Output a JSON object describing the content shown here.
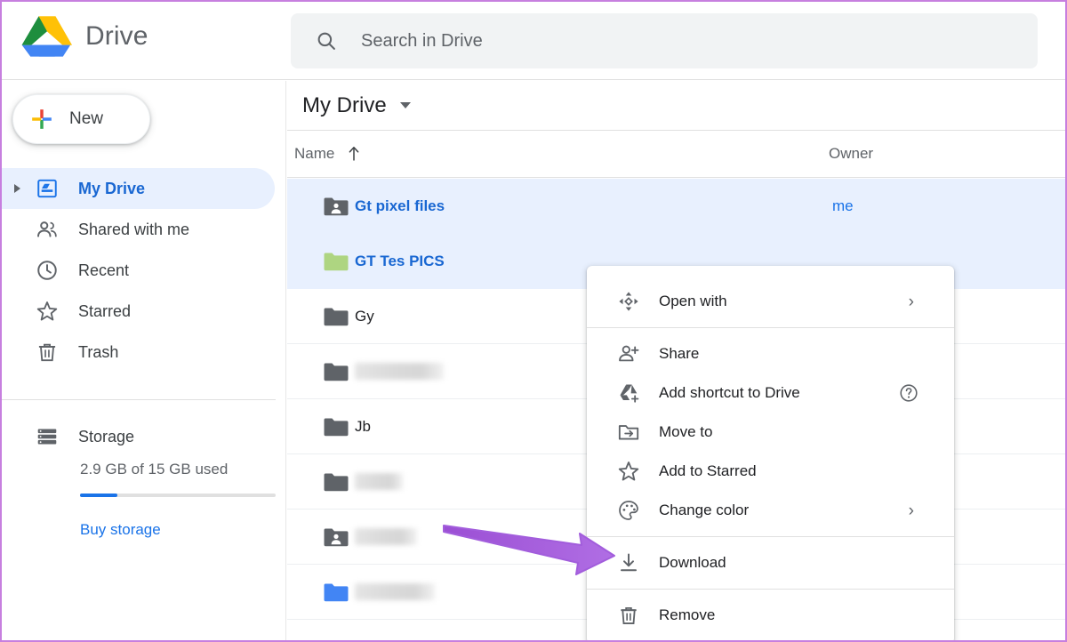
{
  "window": {
    "border_color": "#c77fdf"
  },
  "header": {
    "app_title": "Drive",
    "logo_icon": "google-drive-logo",
    "search": {
      "icon": "search-icon",
      "placeholder": "Search in Drive",
      "value": ""
    }
  },
  "sidebar": {
    "new_button": {
      "label": "New",
      "icon": "plus-icon"
    },
    "items": [
      {
        "label": "My Drive",
        "icon": "my-drive-icon",
        "selected": true,
        "expandable": true
      },
      {
        "label": "Shared with me",
        "icon": "people-icon",
        "selected": false,
        "expandable": false
      },
      {
        "label": "Recent",
        "icon": "clock-icon",
        "selected": false,
        "expandable": false
      },
      {
        "label": "Starred",
        "icon": "star-icon",
        "selected": false,
        "expandable": false
      },
      {
        "label": "Trash",
        "icon": "trash-icon",
        "selected": false,
        "expandable": false
      }
    ],
    "storage": {
      "icon": "storage-icon",
      "label": "Storage",
      "used_text": "2.9 GB of 15 GB used",
      "used_percent": 19,
      "bar_color": "#1a73e8",
      "buy_link": "Buy storage"
    }
  },
  "main": {
    "breadcrumb": {
      "title": "My Drive",
      "caret_icon": "chevron-down-icon"
    },
    "columns": {
      "name": "Name",
      "name_sort_icon": "arrow-up-icon",
      "owner": "Owner"
    },
    "rows": [
      {
        "name": "Gt pixel files",
        "icon": "shared-folder-icon",
        "icon_color": "#5f6368",
        "owner": "me",
        "selected": true,
        "redacted": false
      },
      {
        "name": "GT Tes PICS",
        "icon": "folder-icon",
        "icon_color": "#aed581",
        "owner": "",
        "selected": true,
        "redacted": false
      },
      {
        "name": "Gy",
        "icon": "folder-icon",
        "icon_color": "#5f6368",
        "owner": "",
        "selected": false,
        "redacted": false
      },
      {
        "name": "",
        "icon": "folder-icon",
        "icon_color": "#5f6368",
        "owner": "",
        "selected": false,
        "redacted": true,
        "redact_width": 100
      },
      {
        "name": "Jb",
        "icon": "folder-icon",
        "icon_color": "#5f6368",
        "owner": "",
        "selected": false,
        "redacted": false
      },
      {
        "name": "",
        "icon": "folder-icon",
        "icon_color": "#5f6368",
        "owner": "",
        "selected": false,
        "redacted": true,
        "redact_width": 54
      },
      {
        "name": "",
        "icon": "shared-folder-icon",
        "icon_color": "#5f6368",
        "owner": "",
        "selected": false,
        "redacted": true,
        "redact_width": 70
      },
      {
        "name": "",
        "icon": "folder-icon",
        "icon_color": "#4285f4",
        "owner": "",
        "selected": false,
        "redacted": true,
        "redact_width": 90
      }
    ]
  },
  "context_menu": {
    "groups": [
      {
        "items": [
          {
            "label": "Open with",
            "icon": "open-with-icon",
            "submenu": true,
            "help": false
          }
        ]
      },
      {
        "items": [
          {
            "label": "Share",
            "icon": "person-add-icon",
            "submenu": false,
            "help": false
          },
          {
            "label": "Add shortcut to Drive",
            "icon": "add-shortcut-icon",
            "submenu": false,
            "help": true
          },
          {
            "label": "Move to",
            "icon": "move-to-folder-icon",
            "submenu": false,
            "help": false
          },
          {
            "label": "Add to Starred",
            "icon": "star-icon",
            "submenu": false,
            "help": false
          },
          {
            "label": "Change color",
            "icon": "palette-icon",
            "submenu": true,
            "help": false
          }
        ]
      },
      {
        "items": [
          {
            "label": "Download",
            "icon": "download-icon",
            "submenu": false,
            "help": false
          }
        ]
      },
      {
        "items": [
          {
            "label": "Remove",
            "icon": "trash-icon",
            "submenu": false,
            "help": false
          }
        ]
      }
    ],
    "submenu_glyph": "›",
    "help_glyph": "?"
  },
  "annotation": {
    "arrow_color": "#a25ddc",
    "points_to": "Download"
  }
}
